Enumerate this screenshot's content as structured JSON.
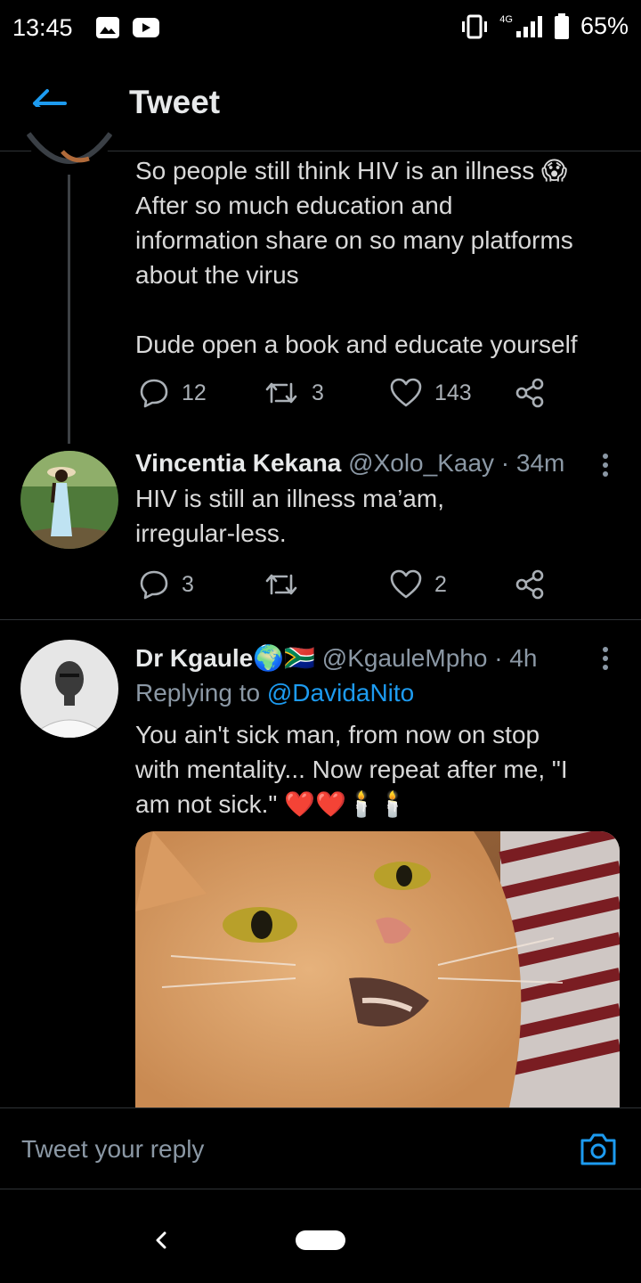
{
  "status_bar": {
    "time": "13:45",
    "network": "4G",
    "battery": "65%"
  },
  "header": {
    "title": "Tweet"
  },
  "tweets": [
    {
      "text": "So people still think HIV is an illness 😱\nAfter so much education and\ninformation share on so many platforms\nabout the virus\n\nDude open a book and educate yourself",
      "replies": "12",
      "retweets": "3",
      "likes": "143"
    },
    {
      "display_name": "Vincentia Kekana",
      "handle": "@Xolo_Kaay",
      "time": "· 34m",
      "text": "HIV is still an illness ma’am,\nirregular-less.",
      "replies": "3",
      "likes": "2"
    },
    {
      "display_name": "Dr Kgaule🌍🇿🇦",
      "handle": "@KgauleMpho",
      "time": "· 4h",
      "replying_prefix": "Replying to",
      "replying_to": "@DavidaNito",
      "text": "You ain't sick man, from now on stop\nwith mentality... Now repeat after me, \"I\nam not sick.\" ❤️❤️🕯️🕯️"
    }
  ],
  "reply_bar": {
    "placeholder": "Tweet your reply"
  },
  "icons": {
    "back": "arrow-left-icon",
    "reply": "speech-bubble-icon",
    "retweet": "retweet-icon",
    "like": "heart-icon",
    "share": "share-icon",
    "more": "vertical-ellipsis-icon",
    "camera": "camera-icon"
  },
  "colors": {
    "accent": "#1d9bf0",
    "background": "#000000",
    "text": "#d9d9d9",
    "muted": "#8b98a5"
  }
}
